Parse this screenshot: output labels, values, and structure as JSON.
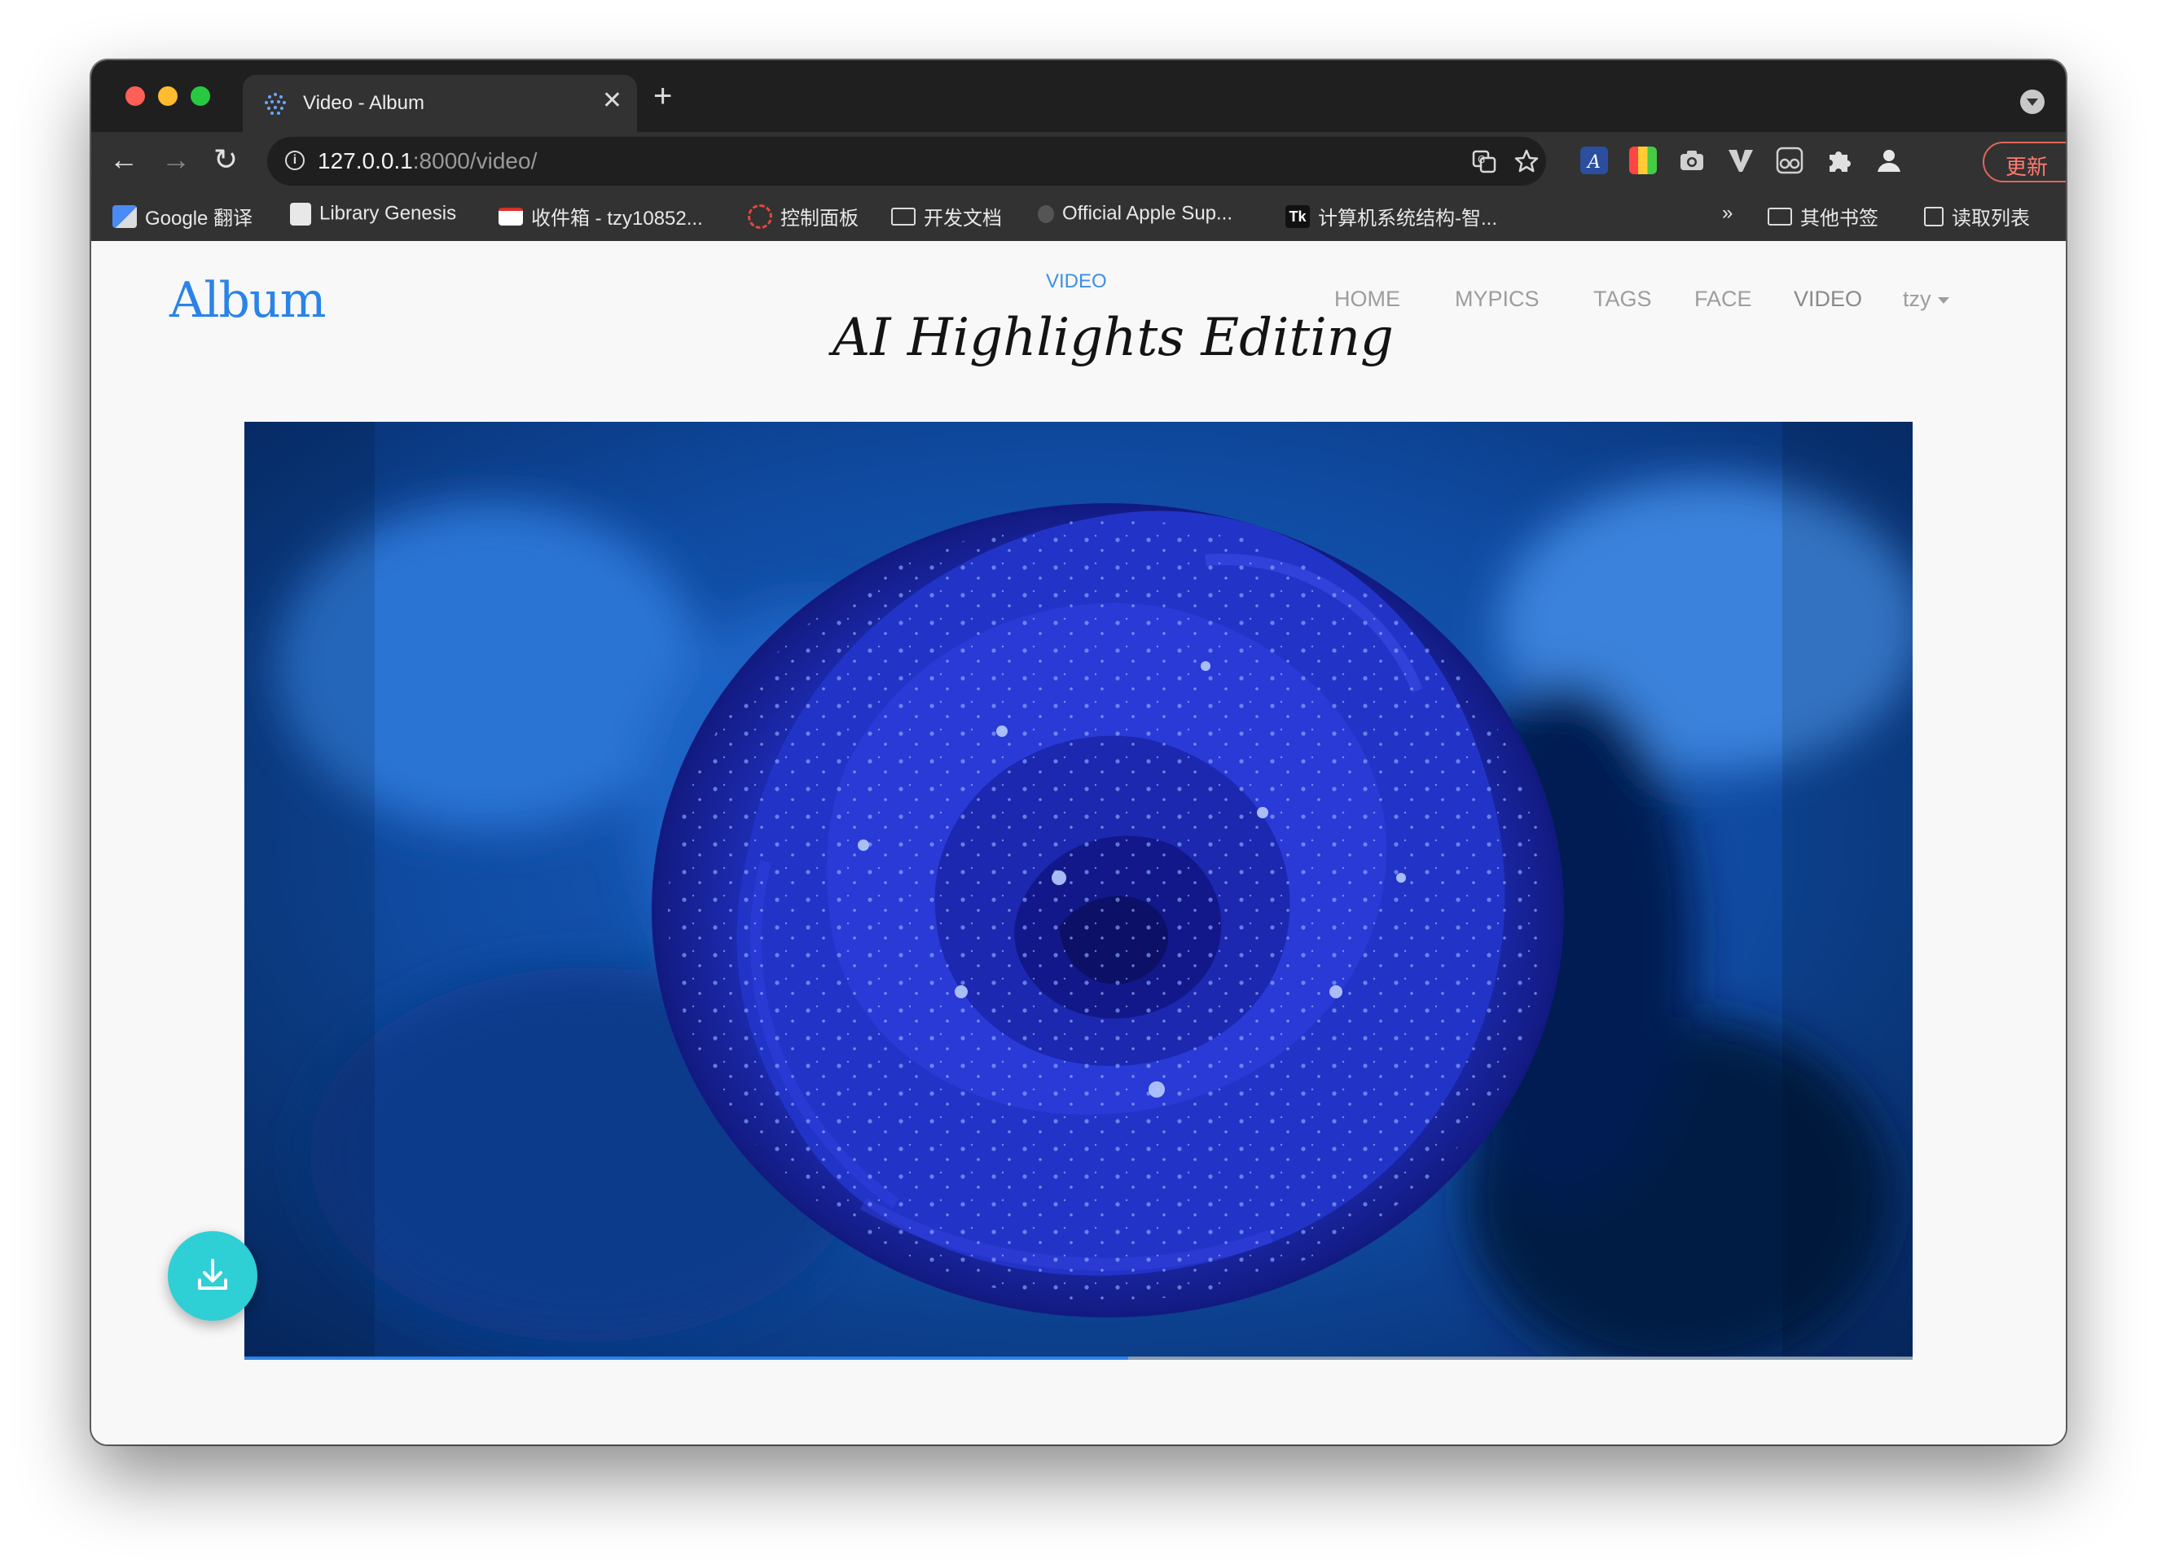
{
  "browser": {
    "tab": {
      "title": "Video - Album",
      "close_glyph": "✕",
      "favicon": "album-favicon-icon"
    },
    "new_tab_glyph": "+",
    "nav": {
      "back_glyph": "←",
      "forward_glyph": "→",
      "reload_glyph": "↻"
    },
    "url": {
      "host": "127.0.0.1",
      "path": ":8000/video/"
    },
    "omnibox_icons": [
      "translate-icon",
      "bookmark-star-icon"
    ],
    "extensions": [
      "text-ext-icon",
      "color-ext-icon",
      "camera-ext-icon",
      "v-ext-icon",
      "glasses-ext-icon",
      "puzzle-extensions-icon",
      "profile-icon"
    ],
    "update_button": {
      "label": "更新",
      "menu_glyph": "⋮"
    },
    "bookmarks": [
      {
        "label": "Google 翻译",
        "icon": "google-translate-icon"
      },
      {
        "label": "Library Genesis",
        "icon": "library-icon"
      },
      {
        "label": "收件箱 - tzy10852...",
        "icon": "gmail-icon"
      },
      {
        "label": "控制面板",
        "icon": "control-panel-icon"
      },
      {
        "label": "开发文档",
        "icon": "folder-icon"
      },
      {
        "label": "Official Apple Sup...",
        "icon": "apple-icon"
      },
      {
        "label": "计算机系统结构-智...",
        "icon": "tk-icon"
      }
    ],
    "bookmarks_overflow": "»",
    "other_bookmarks": "其他书签",
    "reading_list": "读取列表"
  },
  "page": {
    "logo": "Album",
    "section_label": "VIDEO",
    "headline": "AI Highlights Editing",
    "nav_links": [
      "HOME",
      "MYPICS",
      "TAGS",
      "FACE",
      "VIDEO"
    ],
    "user": "tzy",
    "video": {
      "subject": "blue rose with water droplets",
      "progress_fraction": 0.53
    },
    "download_button": "download-icon"
  },
  "colors": {
    "accent": "#2a83e8",
    "fab": "#2fcfd6",
    "update": "#e0675c",
    "chrome_dark": "#1f1f1f",
    "chrome_toolbar": "#323232"
  }
}
